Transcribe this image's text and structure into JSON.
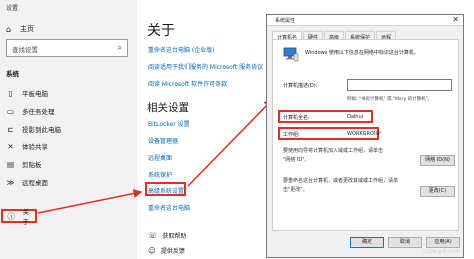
{
  "sidebar": {
    "title": "设置",
    "home": "主页",
    "search_placeholder": "查找设置",
    "section": "系统",
    "items": [
      {
        "label": "平板电脑"
      },
      {
        "label": "多任务处理"
      },
      {
        "label": "投影到此电脑"
      },
      {
        "label": "体验共享"
      },
      {
        "label": "剪贴板"
      },
      {
        "label": "远程桌面"
      },
      {
        "label": "关于"
      }
    ]
  },
  "main": {
    "title": "关于",
    "links": [
      "重命名这台电脑 (企业版)",
      "阅读适用于我们服务的 Microsoft 服务协议",
      "阅读 Microsoft 软件许可条款"
    ],
    "related_title": "相关设置",
    "related_links": [
      "BitLocker 设置",
      "设备管理器",
      "远程桌面",
      "系统保护",
      "高级系统设置",
      "重命名这台电脑"
    ],
    "help_items": [
      "获取帮助",
      "提供反馈"
    ]
  },
  "dialog": {
    "title": "系统属性",
    "close_glyph": "✕",
    "tabs": [
      "计算机名",
      "硬件",
      "高级",
      "系统保护",
      "远程"
    ],
    "intro": "Windows 使用以下信息在网络中标识这台计算机。",
    "desc_label": "计算机描述(D):",
    "desc_value": "",
    "desc_example": "例如: \"书房计算机\" 或 \"Mary 的计算机\"。",
    "fullname_label": "计算机全名:",
    "fullname_value": "Daihui",
    "workgroup_label": "工作组:",
    "workgroup_value": "WORKGROUP",
    "network_id_text": [
      "要使用向导将计算机加入域或工作组，请单击",
      "\"网络 ID\"。"
    ],
    "network_id_button": "网络 ID(N)",
    "rename_text": [
      "要重命名这台计算机，或者更改其域或工作组，请单",
      "击\"更改\"。"
    ],
    "change_button": "更改(C)",
    "ok_button": "确定",
    "cancel_button": "取消",
    "apply_button": "应用(A)",
    "watermark": "CSDN @学习大师"
  },
  "colors": {
    "accent": "#0066b4",
    "highlight": "#e0301e"
  }
}
